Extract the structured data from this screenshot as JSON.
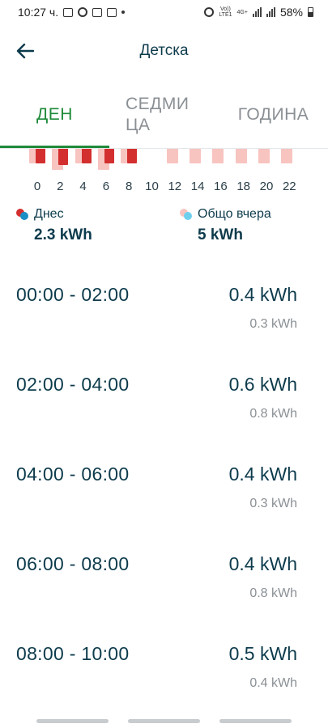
{
  "status_bar": {
    "time": "10:27 ч.",
    "network": "LTE1",
    "network_top": "Vo))",
    "net_gen": "4G+",
    "battery": "58%"
  },
  "header": {
    "title": "Детска",
    "back_icon": "arrow-left-icon"
  },
  "tabs": [
    {
      "label": "ДЕН",
      "active": true
    },
    {
      "label": "СЕДМИ\nЦА",
      "active": false
    },
    {
      "label": "ГОДИНА",
      "active": false
    }
  ],
  "colors": {
    "accent_green": "#1f8a3a",
    "bar_today": "#d32f2f",
    "bar_yesterday": "#f8c4c0",
    "text_dark": "#0d3b4c"
  },
  "chart_data": {
    "type": "bar",
    "x_ticks": [
      "0",
      "2",
      "4",
      "6",
      "8",
      "10",
      "12",
      "14",
      "16",
      "18",
      "20",
      "22"
    ],
    "series": [
      {
        "name": "Днес",
        "color": "#d32f2f",
        "values": [
          0.4,
          0.6,
          0.4,
          0.4,
          0.5,
          null,
          null,
          null,
          null,
          null,
          null,
          null
        ]
      },
      {
        "name": "Общо вчера",
        "color": "#f8c4c0",
        "values": [
          0.3,
          0.8,
          0.3,
          0.8,
          0.4,
          null,
          0.4,
          0.4,
          0.4,
          0.4,
          0.4,
          0.4
        ]
      }
    ]
  },
  "legend": {
    "today_label": "Днес",
    "today_value": "2.3 kWh",
    "yesterday_label": "Общо вчера",
    "yesterday_value": "5 kWh"
  },
  "rows": [
    {
      "range": "00:00 - 02:00",
      "value": "0.4 kWh",
      "prev": "0.3 kWh"
    },
    {
      "range": "02:00 - 04:00",
      "value": "0.6 kWh",
      "prev": "0.8 kWh"
    },
    {
      "range": "04:00 - 06:00",
      "value": "0.4 kWh",
      "prev": "0.3 kWh"
    },
    {
      "range": "06:00 - 08:00",
      "value": "0.4 kWh",
      "prev": "0.8 kWh"
    },
    {
      "range": "08:00 - 10:00",
      "value": "0.5 kWh",
      "prev": "0.4 kWh"
    }
  ]
}
